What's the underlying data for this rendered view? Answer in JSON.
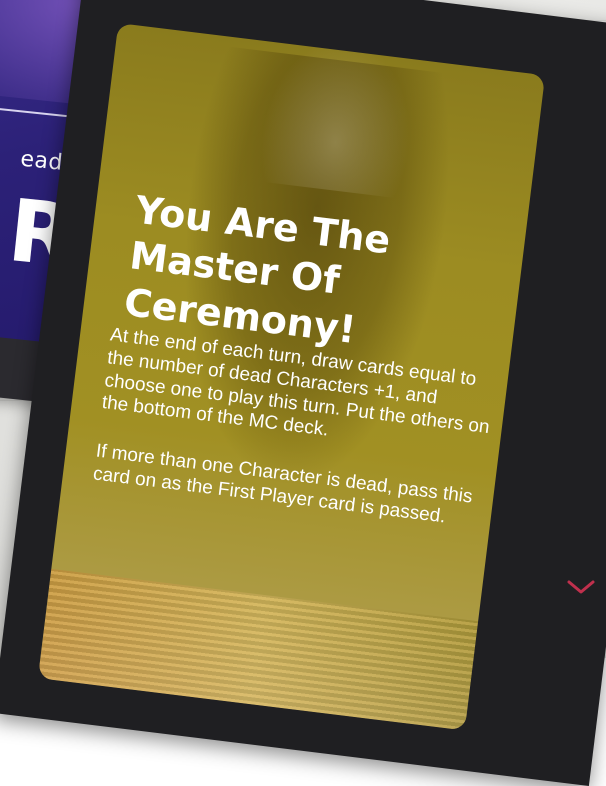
{
  "back_card": {
    "label": "ead:",
    "big_char": "R"
  },
  "front_card": {
    "title": "You Are The Master Of Ceremony!",
    "paragraphs": [
      "At the end of each turn, draw cards equal to the number of dead Characters +1, and choose one to play this turn. Put the others on the bottom of the MC deck.",
      "If more than one Character is dead, pass this card on as the First Player card is passed."
    ]
  },
  "colors": {
    "accent_chevron": "#c0304d",
    "card_gold": "#9c8c22",
    "back_card_purple": "#2c2178"
  },
  "icons": [
    "chevron-down-icon"
  ]
}
